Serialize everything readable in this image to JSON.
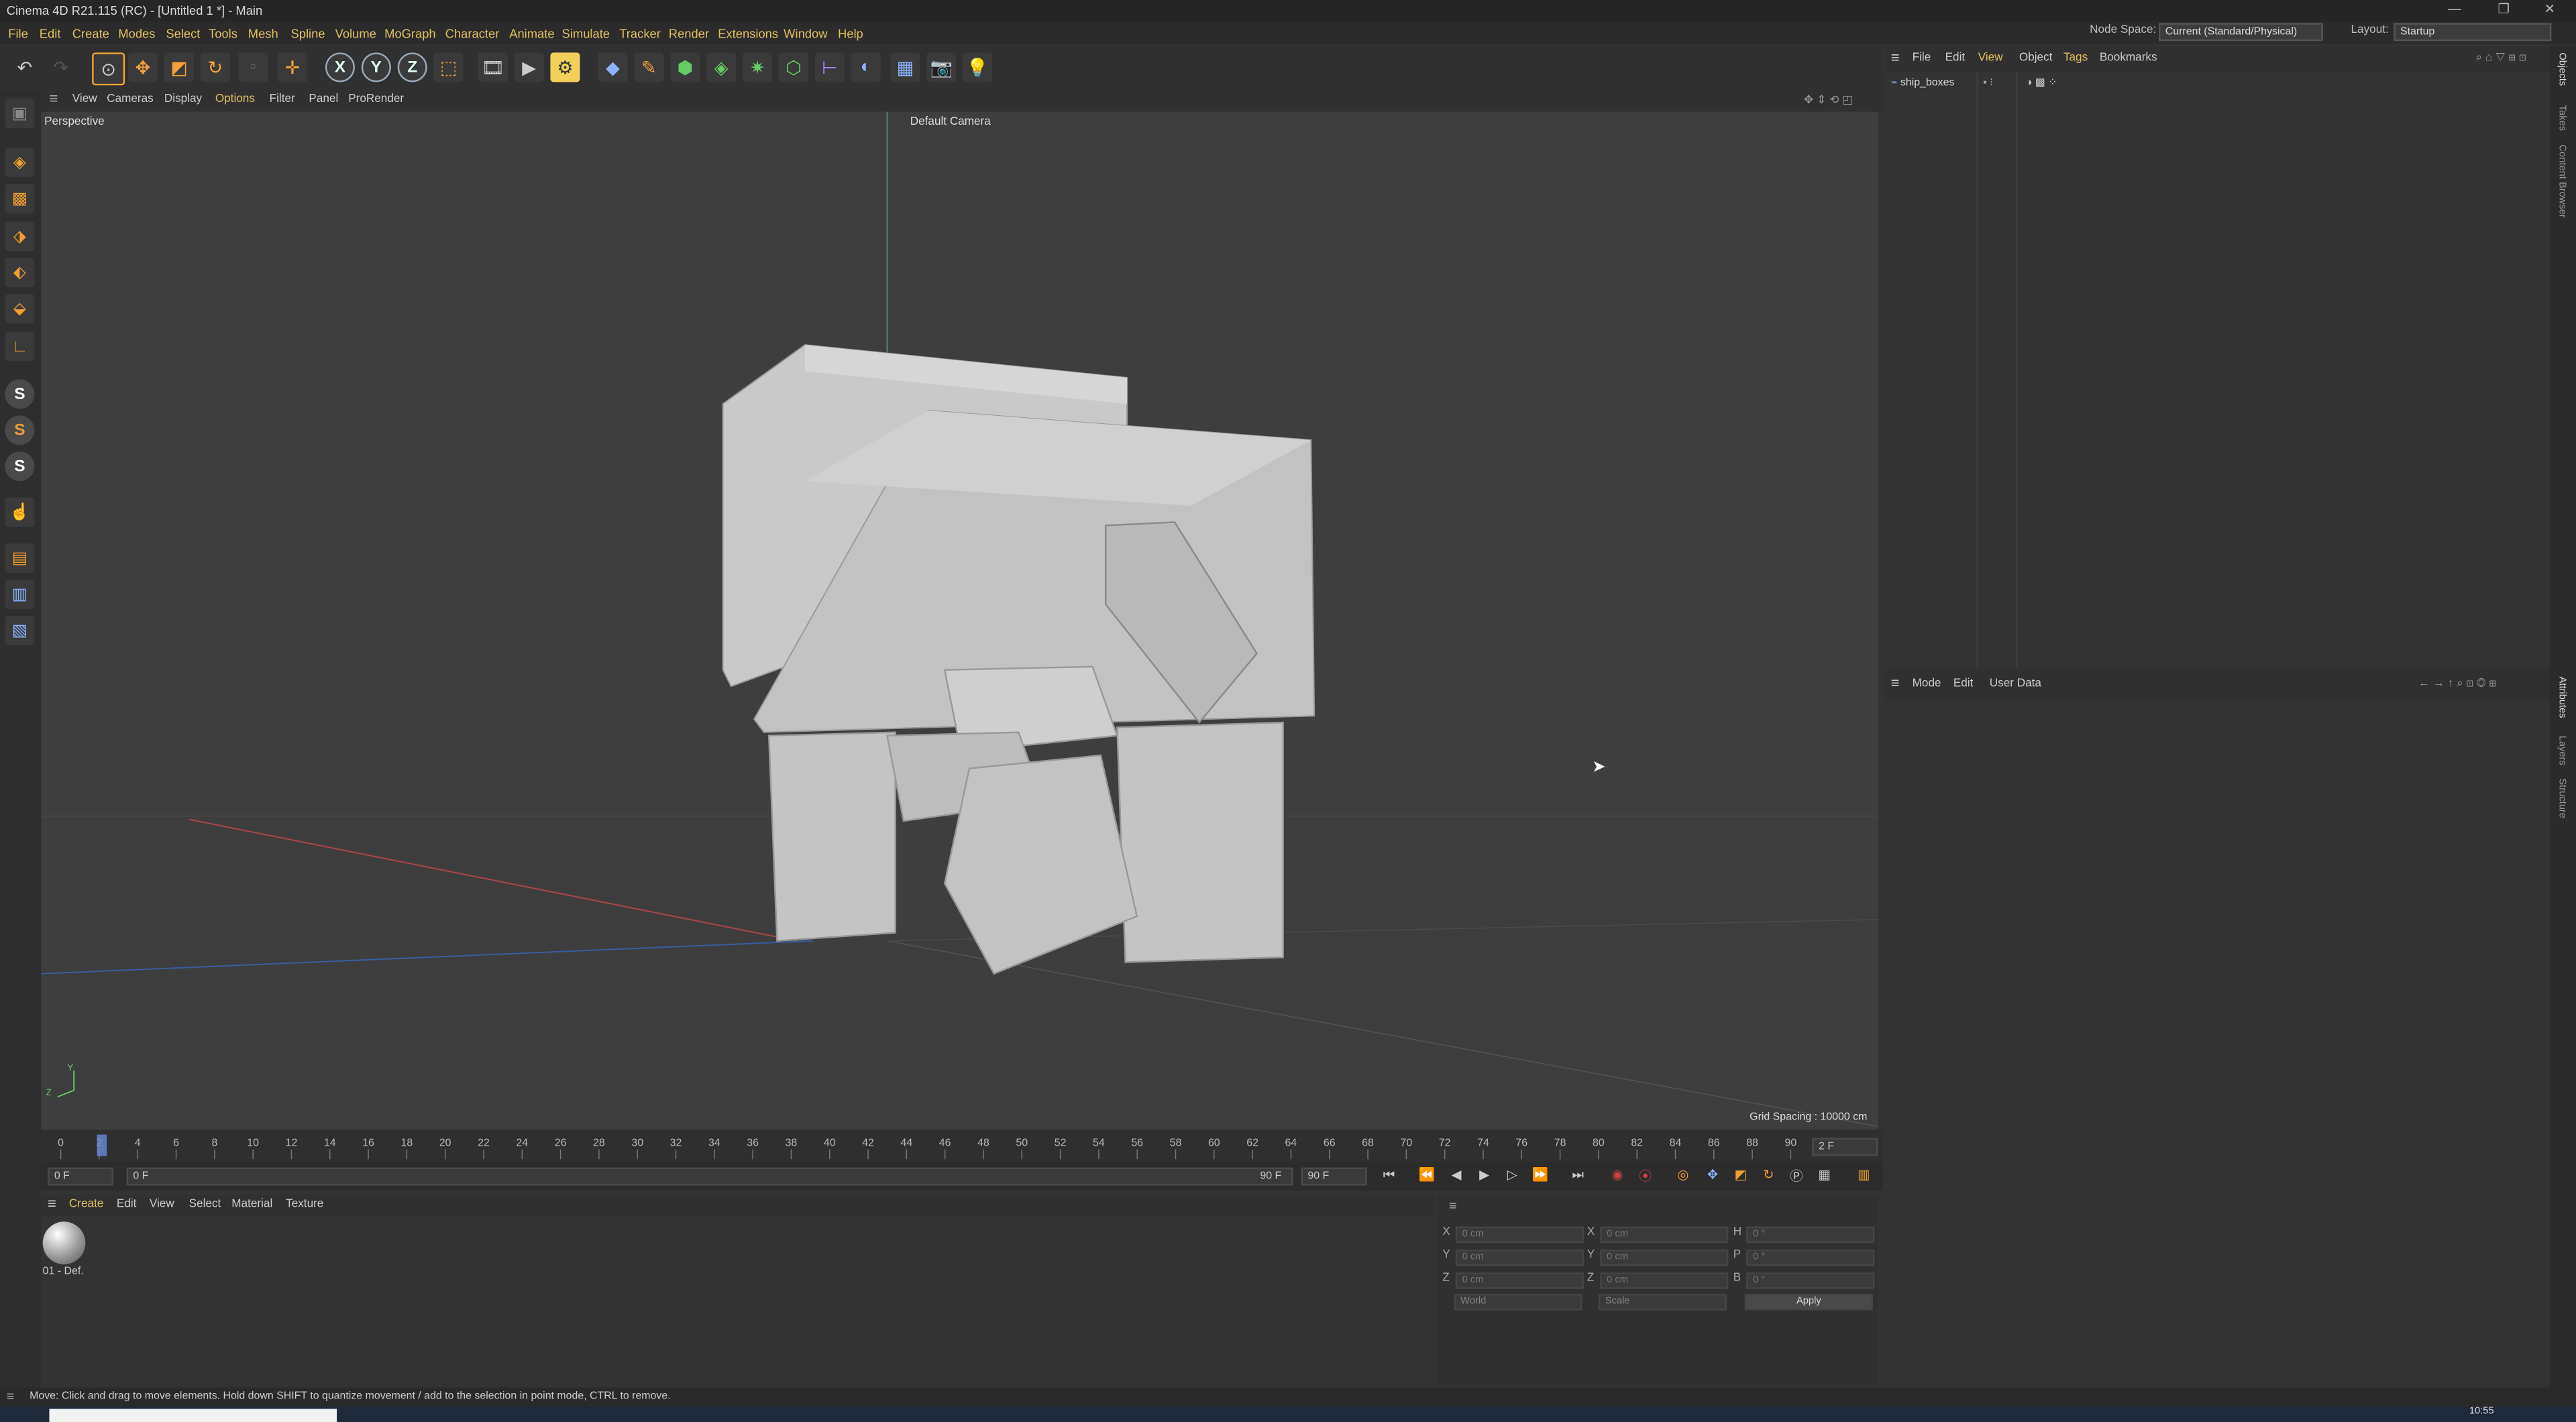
{
  "window": {
    "title": "Cinema 4D R21.115 (RC) - [Untitled 1 *] - Main"
  },
  "menubar": {
    "items": [
      "File",
      "Edit",
      "Create",
      "Modes",
      "Select",
      "Tools",
      "Mesh",
      "Spline",
      "Volume",
      "MoGraph",
      "Character",
      "Animate",
      "Simulate",
      "Tracker",
      "Render",
      "Extensions",
      "Window",
      "Help"
    ],
    "node_space_label": "Node Space:",
    "node_space_value": "Current (Standard/Physical)",
    "layout_label": "Layout:",
    "layout_value": "Startup"
  },
  "viewport": {
    "menu": [
      "View",
      "Cameras",
      "Display",
      "Options",
      "Filter",
      "Panel",
      "ProRender"
    ],
    "view_name": "Perspective",
    "camera": "Default Camera",
    "grid_spacing": "Grid Spacing : 10000 cm"
  },
  "timeline": {
    "ticks": [
      "0",
      "2",
      "4",
      "6",
      "8",
      "10",
      "12",
      "14",
      "16",
      "18",
      "20",
      "22",
      "24",
      "26",
      "28",
      "30",
      "32",
      "34",
      "36",
      "38",
      "40",
      "42",
      "44",
      "46",
      "48",
      "50",
      "52",
      "54",
      "56",
      "58",
      "60",
      "62",
      "64",
      "66",
      "68",
      "70",
      "72",
      "74",
      "76",
      "78",
      "80",
      "82",
      "84",
      "86",
      "88",
      "90"
    ],
    "current_frame_box": "2 F",
    "start": "0 F",
    "preview_start": "0 F",
    "preview_end": "90 F",
    "end": "90 F"
  },
  "materials": {
    "menu": [
      "Create",
      "Edit",
      "View",
      "Select",
      "Material",
      "Texture"
    ],
    "items": [
      {
        "name": "01 - Def."
      }
    ]
  },
  "coordinates": {
    "pos_labels": [
      "X",
      "Y",
      "Z"
    ],
    "size_labels": [
      "X",
      "Y",
      "Z"
    ],
    "rot_labels": [
      "H",
      "P",
      "B"
    ],
    "pos_values": [
      "0 cm",
      "0 cm",
      "0 cm"
    ],
    "size_values": [
      "0 cm",
      "0 cm",
      "0 cm"
    ],
    "rot_values": [
      "0 °",
      "0 °",
      "0 °"
    ],
    "world": "World",
    "scale": "Scale",
    "apply": "Apply"
  },
  "objects": {
    "menu": [
      "File",
      "Edit",
      "View",
      "Object",
      "Tags",
      "Bookmarks"
    ],
    "items": [
      {
        "name": "ship_boxes"
      }
    ]
  },
  "attributes": {
    "menu": [
      "Mode",
      "Edit",
      "User Data"
    ]
  },
  "side_tabs": {
    "top": [
      "Objects",
      "Takes",
      "Content Browser"
    ],
    "bottom": [
      "Attributes",
      "Layers",
      "Structure"
    ]
  },
  "status": {
    "text": "Move: Click and drag to move elements. Hold down SHIFT to quantize movement / add to the selection in point mode, CTRL to remove."
  },
  "taskbar": {
    "clock": "10:55"
  }
}
